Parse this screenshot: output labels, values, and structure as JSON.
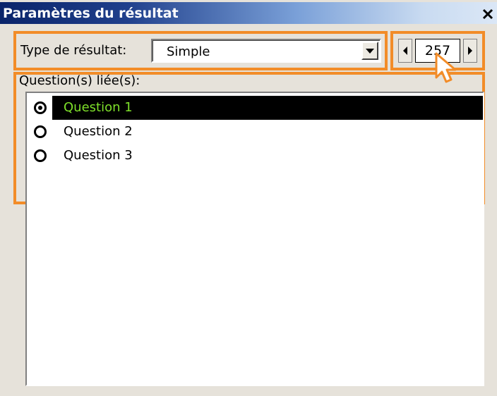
{
  "window": {
    "title": "Paramètres du résultat",
    "close_glyph": "✕"
  },
  "type_row": {
    "label": "Type de résultat:",
    "selected_value": "Simple"
  },
  "stepper": {
    "value": "257",
    "prev_icon": "arrow-left-icon",
    "next_icon": "arrow-right-icon"
  },
  "linked_questions": {
    "label": "Question(s) liée(s):",
    "items": [
      {
        "label": "Question 1",
        "selected": true
      },
      {
        "label": "Question 2",
        "selected": false
      },
      {
        "label": "Question 3",
        "selected": false
      }
    ]
  },
  "colors": {
    "highlight": "#f28c28",
    "selected_text": "#7ee02a",
    "title_bar": "#0a246a"
  }
}
